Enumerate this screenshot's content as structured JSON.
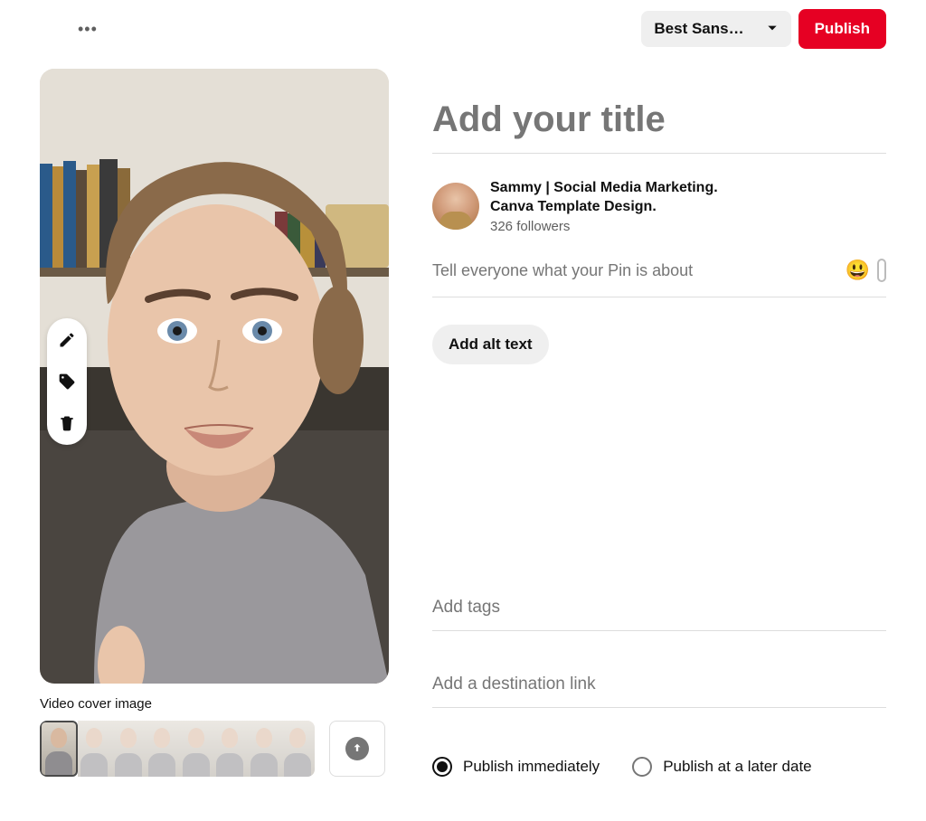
{
  "header": {
    "board_selected": "Best Sans…",
    "publish_label": "Publish"
  },
  "preview": {
    "cover_label": "Video cover image"
  },
  "form": {
    "title_placeholder": "Add your title",
    "description_placeholder": "Tell everyone what your Pin is about",
    "alt_text_button": "Add alt text",
    "tags_placeholder": "Add tags",
    "link_placeholder": "Add a destination link"
  },
  "user": {
    "name_line1": "Sammy | Social Media Marketing.",
    "name_line2": "Canva Template Design.",
    "followers": "326 followers"
  },
  "publish_options": {
    "immediate": "Publish immediately",
    "later": "Publish at a later date"
  }
}
